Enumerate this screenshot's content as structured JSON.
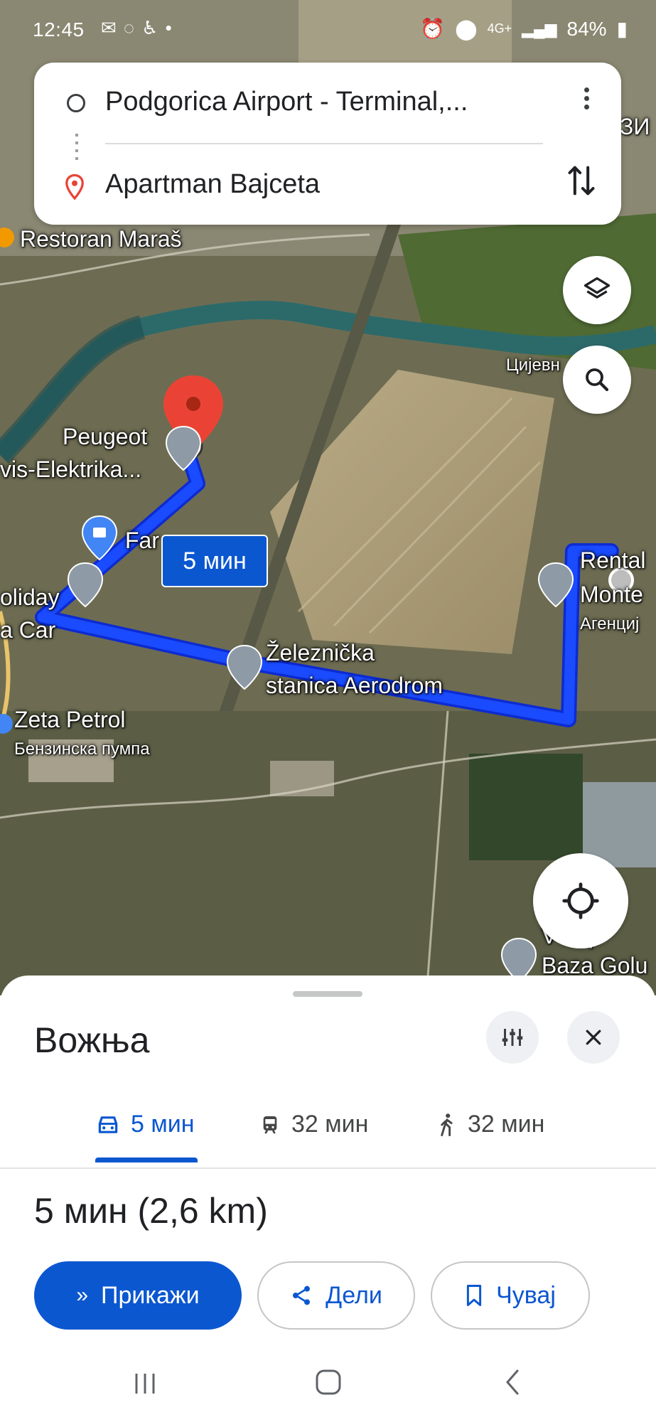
{
  "status_bar": {
    "time": "12:45",
    "network": "4G+",
    "battery": "84%"
  },
  "directions": {
    "origin": "Podgorica Airport - Terminal,...",
    "destination": "Apartman Bajceta"
  },
  "map": {
    "labels": {
      "restoran": "Restoran Maraš",
      "cijevna": "Цијевн",
      "peugeot_1": "Peugeot",
      "peugeot_2": "vis-Elektrika...",
      "fam": "Far",
      "holiday_1": "oliday",
      "holiday_2": "a Car",
      "zeleznicka_1": "Železnička",
      "zeleznicka_2": "stanica Aerodrom",
      "rental_1": "Rental",
      "rental_2": "Monte",
      "agencija": "Агенциј",
      "zeta_petrol": "Zeta Petrol",
      "benzinska": "Бензинска пумпа",
      "baza_1": "V   nop",
      "baza_2": "Baza Golu",
      "top_right": "ЗИ"
    },
    "route_time_badge": "5 мин",
    "route_color": "#1a4bff"
  },
  "sheet": {
    "title": "Вожња",
    "tabs": [
      {
        "label": "5 мин",
        "icon": "car-icon",
        "active": true
      },
      {
        "label": "32 мин",
        "icon": "train-icon",
        "active": false
      },
      {
        "label": "32 мин",
        "icon": "walk-icon",
        "active": false
      }
    ],
    "summary": "5 мин (2,6 km)",
    "buttons": {
      "start": "Прикажи",
      "share": "Дели",
      "save": "Чувај"
    }
  },
  "colors": {
    "accent": "#0b57d0",
    "pin_red": "#ea4335"
  }
}
